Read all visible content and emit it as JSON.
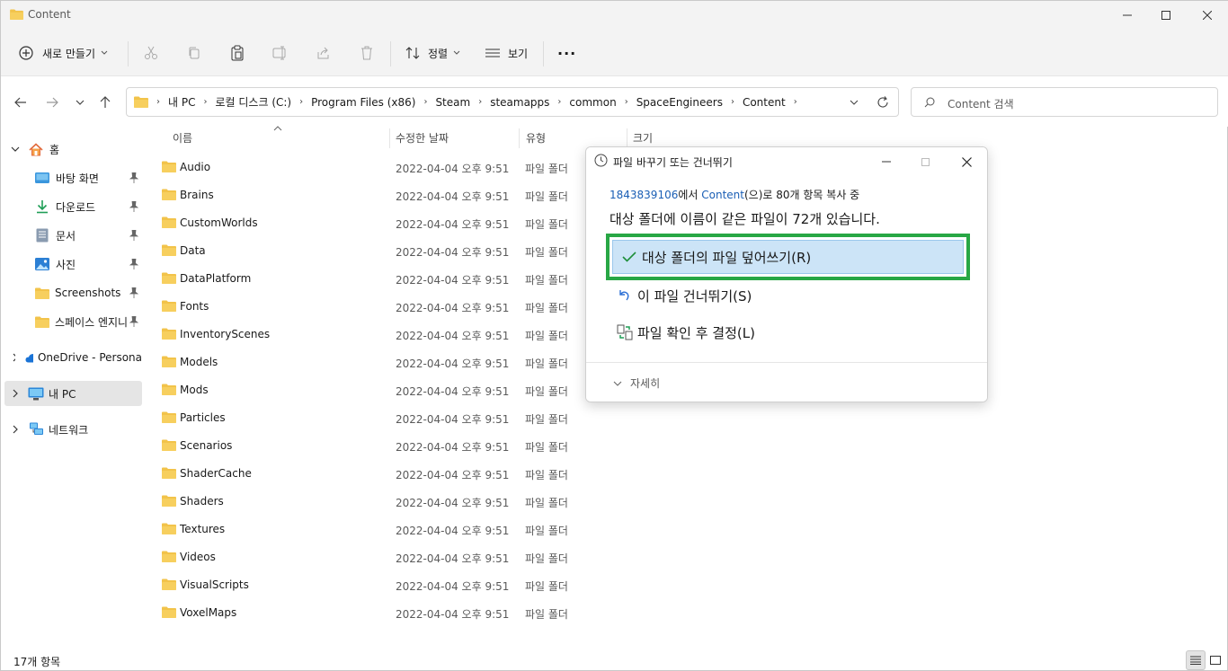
{
  "window": {
    "title": "Content",
    "controls": [
      "minimize-icon",
      "maximize-icon",
      "close-icon"
    ]
  },
  "toolbar": {
    "new_label": "새로 만들기",
    "sort_label": "정렬",
    "view_label": "보기",
    "more_label": "···"
  },
  "address": {
    "breadcrumb": [
      "내 PC",
      "로컬 디스크 (C:)",
      "Program Files (x86)",
      "Steam",
      "steamapps",
      "common",
      "SpaceEngineers",
      "Content"
    ],
    "search_placeholder": "Content 검색"
  },
  "sidebar": {
    "home": "홈",
    "items": [
      {
        "label": "바탕 화면",
        "icon": "desktop-icon"
      },
      {
        "label": "다운로드",
        "icon": "download-icon"
      },
      {
        "label": "문서",
        "icon": "document-icon"
      },
      {
        "label": "사진",
        "icon": "pictures-icon"
      },
      {
        "label": "Screenshots",
        "icon": "folder-icon"
      },
      {
        "label": "스페이스 엔지니",
        "icon": "folder-icon"
      }
    ],
    "onedrive": "OneDrive - Persona",
    "thispc": "내 PC",
    "network": "네트워크"
  },
  "columns": {
    "name": "이름",
    "modified": "수정한 날짜",
    "type": "유형",
    "size": "크기"
  },
  "files": [
    {
      "name": "Audio",
      "modified": "2022-04-04 오후 9:51",
      "type": "파일 폴더"
    },
    {
      "name": "Brains",
      "modified": "2022-04-04 오후 9:51",
      "type": "파일 폴더"
    },
    {
      "name": "CustomWorlds",
      "modified": "2022-04-04 오후 9:51",
      "type": "파일 폴더"
    },
    {
      "name": "Data",
      "modified": "2022-04-04 오후 9:51",
      "type": "파일 폴더"
    },
    {
      "name": "DataPlatform",
      "modified": "2022-04-04 오후 9:51",
      "type": "파일 폴더"
    },
    {
      "name": "Fonts",
      "modified": "2022-04-04 오후 9:51",
      "type": "파일 폴더"
    },
    {
      "name": "InventoryScenes",
      "modified": "2022-04-04 오후 9:51",
      "type": "파일 폴더"
    },
    {
      "name": "Models",
      "modified": "2022-04-04 오후 9:51",
      "type": "파일 폴더"
    },
    {
      "name": "Mods",
      "modified": "2022-04-04 오후 9:51",
      "type": "파일 폴더"
    },
    {
      "name": "Particles",
      "modified": "2022-04-04 오후 9:51",
      "type": "파일 폴더"
    },
    {
      "name": "Scenarios",
      "modified": "2022-04-04 오후 9:51",
      "type": "파일 폴더"
    },
    {
      "name": "ShaderCache",
      "modified": "2022-04-04 오후 9:51",
      "type": "파일 폴더"
    },
    {
      "name": "Shaders",
      "modified": "2022-04-04 오후 9:51",
      "type": "파일 폴더"
    },
    {
      "name": "Textures",
      "modified": "2022-04-04 오후 9:51",
      "type": "파일 폴더"
    },
    {
      "name": "Videos",
      "modified": "2022-04-04 오후 9:51",
      "type": "파일 폴더"
    },
    {
      "name": "VisualScripts",
      "modified": "2022-04-04 오후 9:51",
      "type": "파일 폴더"
    },
    {
      "name": "VoxelMaps",
      "modified": "2022-04-04 오후 9:51",
      "type": "파일 폴더"
    }
  ],
  "status": {
    "count": "17개 항목"
  },
  "dialog": {
    "title": "파일 바꾸기 또는 건너뛰기",
    "progress_source": "1843839106",
    "progress_mid": "에서 ",
    "progress_dest": "Content",
    "progress_tail": "(으)로 80개 항목 복사 중",
    "message": "대상 폴더에 이름이 같은 파일이 72개 있습니다.",
    "option_replace": "대상 폴더의 파일 덮어쓰기(R)",
    "option_skip": "이 파일 건너뛰기(S)",
    "option_decide": "파일 확인 후 결정(L)",
    "details": "자세히"
  },
  "colors": {
    "folder": "#f2c34a",
    "highlight_border": "#28a745",
    "selected_option": "#cce4f7",
    "link": "#1b5fb5"
  }
}
